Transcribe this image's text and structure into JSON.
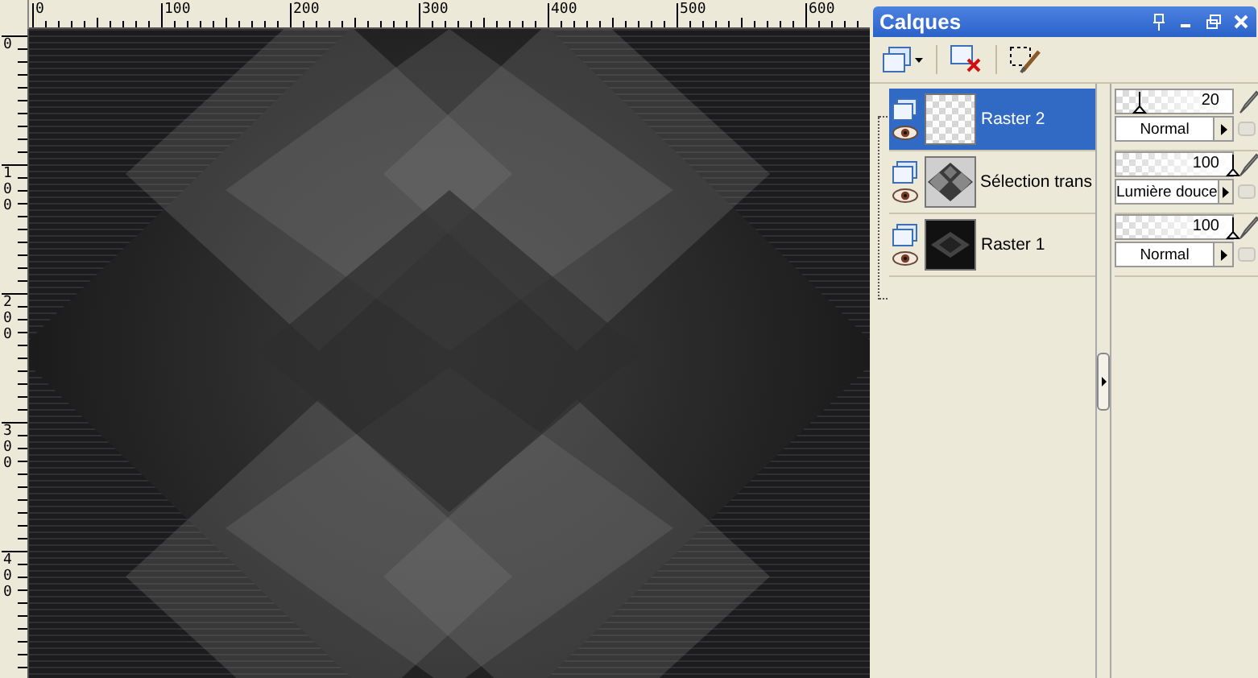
{
  "rulers": {
    "horizontal": [
      "0",
      "100",
      "200",
      "300",
      "400",
      "500",
      "600"
    ],
    "vertical": [
      "0",
      "100",
      "200",
      "300",
      "400"
    ]
  },
  "palette": {
    "title": "Calques"
  },
  "layers": [
    {
      "name": "Raster 2",
      "selected": true,
      "kind": "transparent",
      "opacity": "20",
      "level": 0.2,
      "blend_mode": "Normal"
    },
    {
      "name": "Sélection trans",
      "selected": false,
      "kind": "pattern",
      "opacity": "100",
      "level": 1,
      "blend_mode": "Lumière douce"
    },
    {
      "name": "Raster 1",
      "selected": false,
      "kind": "dark",
      "opacity": "100",
      "level": 1,
      "blend_mode": "Normal"
    }
  ]
}
